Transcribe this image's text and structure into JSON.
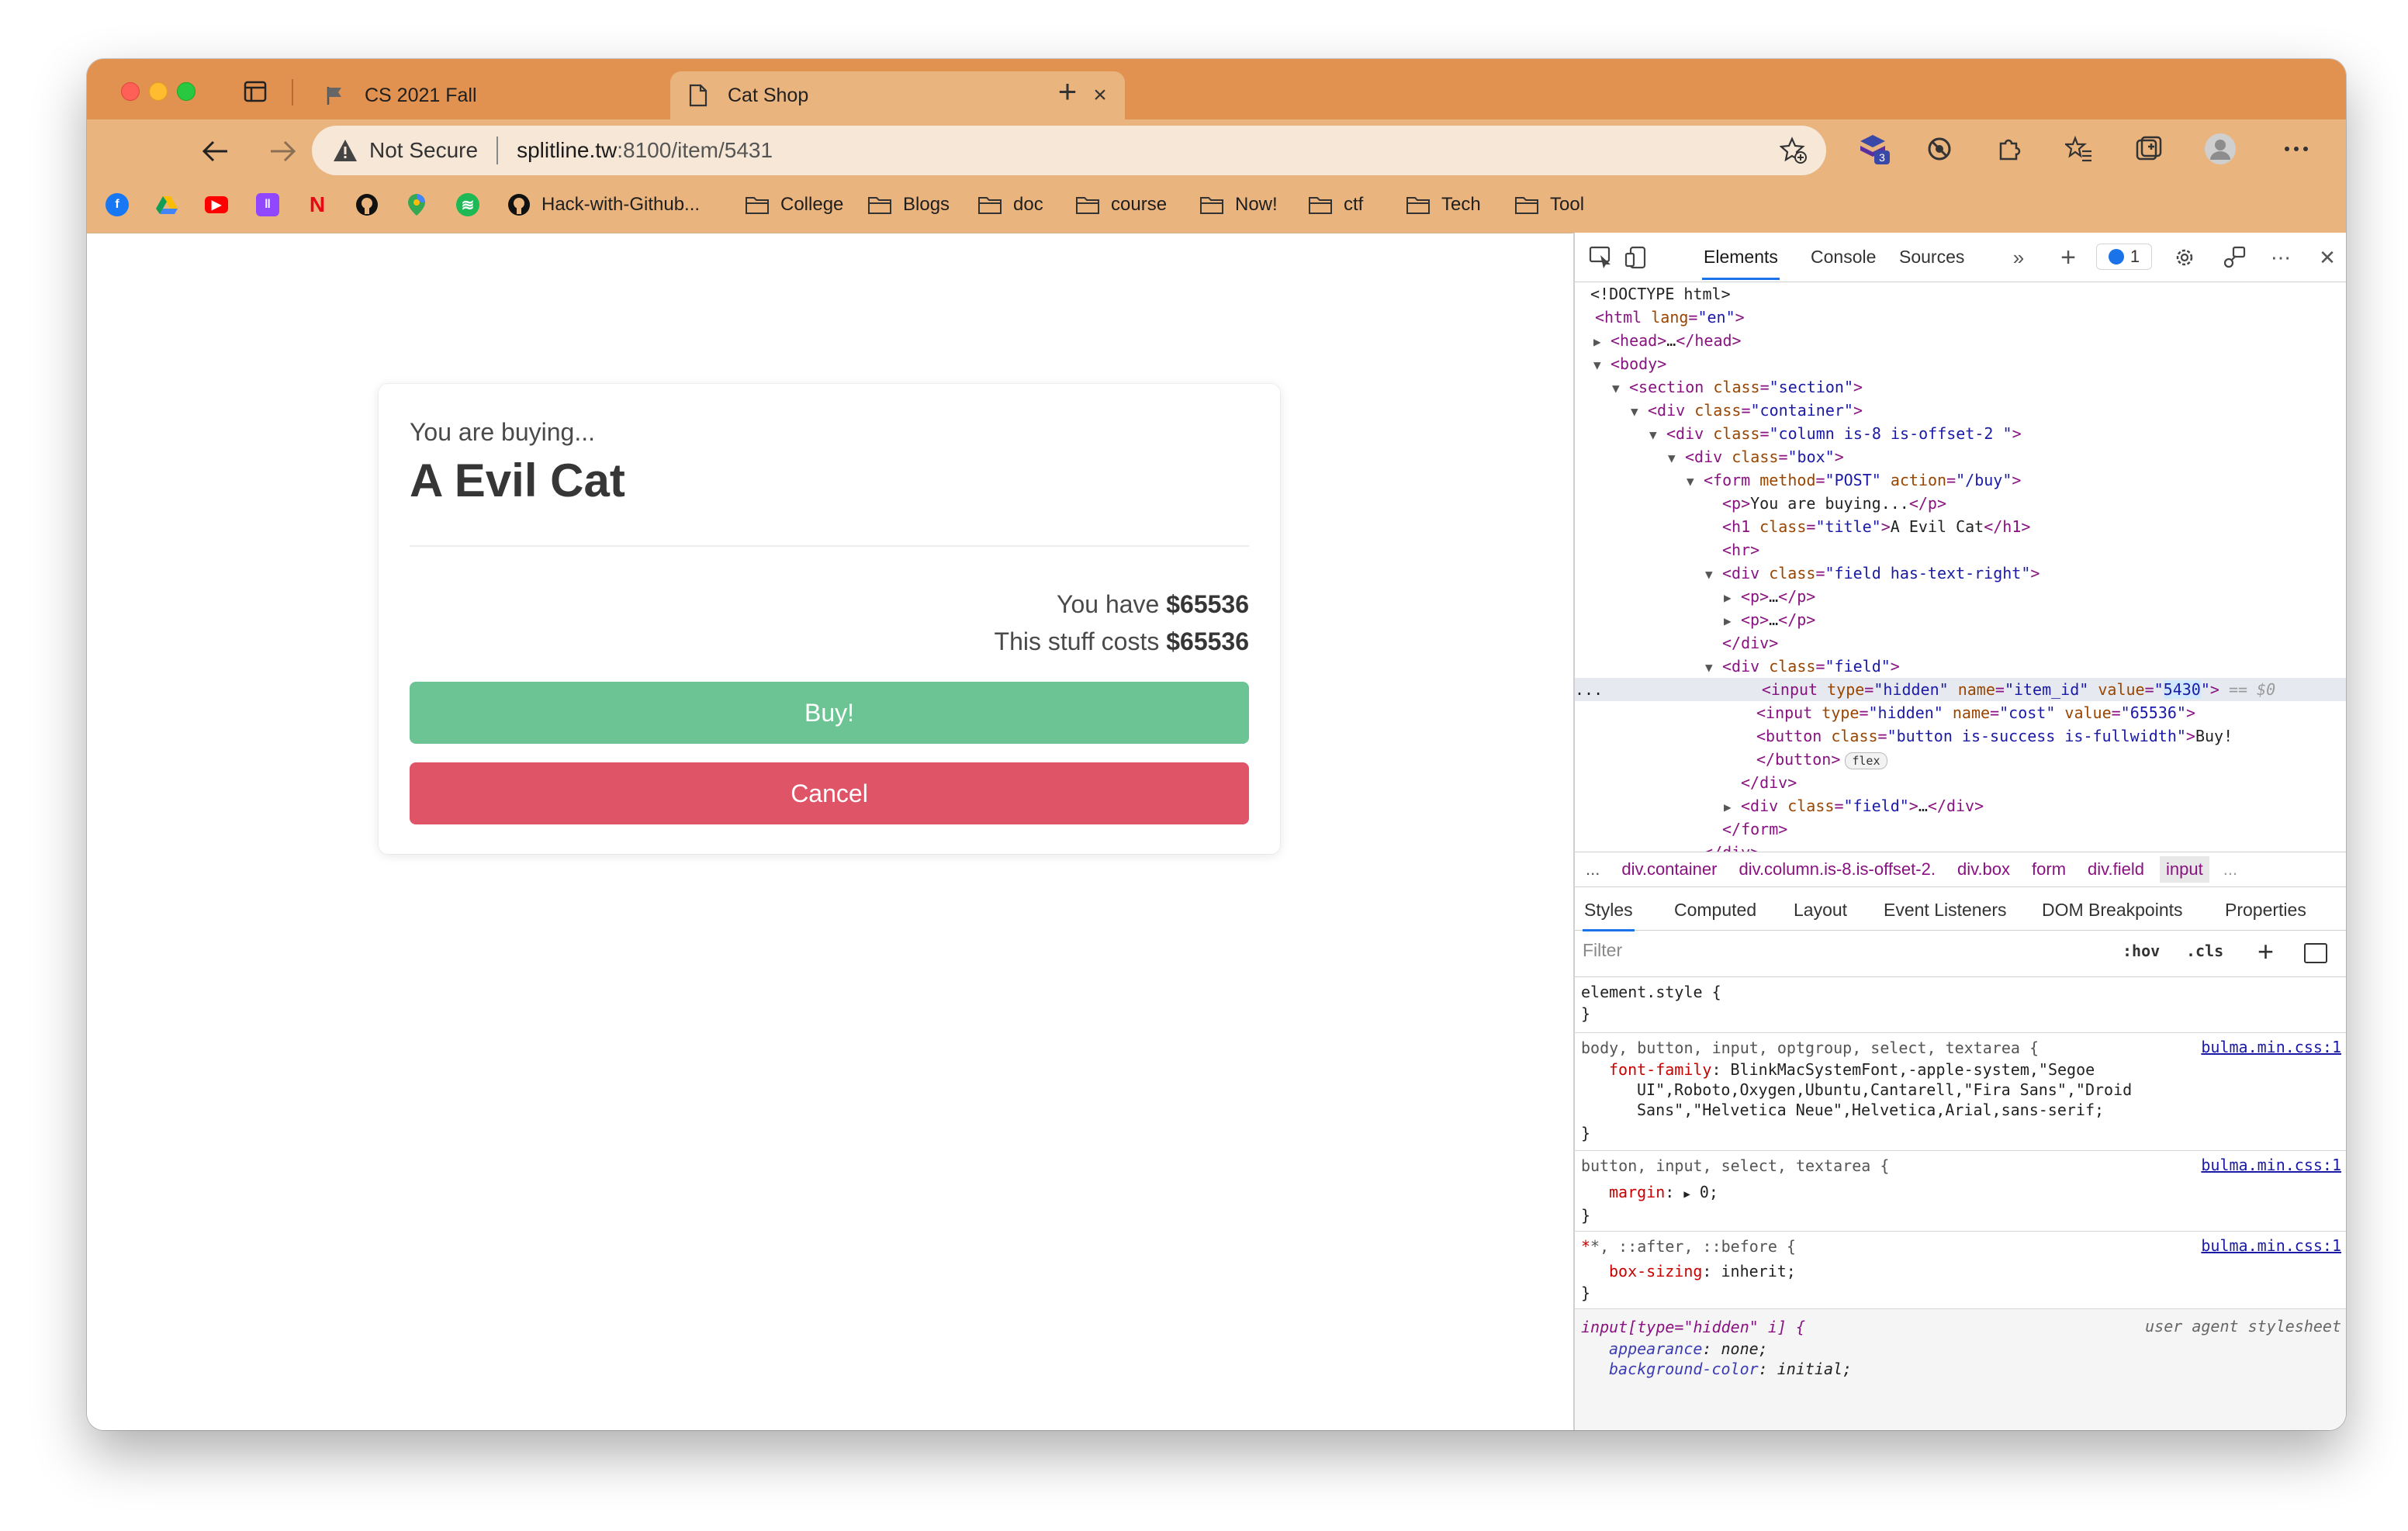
{
  "browser": {
    "tabs": [
      {
        "label": "CS 2021 Fall",
        "icon": "flag-icon",
        "active": false
      },
      {
        "label": "Cat Shop",
        "icon": "page-icon",
        "active": true
      }
    ],
    "security_label": "Not Secure",
    "url_host": "splitline.tw",
    "url_rest": ":8100/item/5431",
    "extension_badge": "3",
    "bookmarks": [
      {
        "label": "Hack-with-Github...",
        "icon": "github-icon"
      },
      {
        "label": "College",
        "icon": "folder-icon"
      },
      {
        "label": "Blogs",
        "icon": "folder-icon"
      },
      {
        "label": "doc",
        "icon": "folder-icon"
      },
      {
        "label": "course",
        "icon": "folder-icon"
      },
      {
        "label": "Now!",
        "icon": "folder-icon"
      },
      {
        "label": "ctf",
        "icon": "folder-icon"
      },
      {
        "label": "Tech",
        "icon": "folder-icon"
      },
      {
        "label": "Tool",
        "icon": "folder-icon"
      }
    ],
    "colors": {
      "tabstrip": "#e19150",
      "toolbar": "#eab47f"
    }
  },
  "page": {
    "subtitle": "You are buying...",
    "title": "A Evil Cat",
    "have_prefix": "You have ",
    "have_amount": "$65536",
    "cost_prefix": "This stuff costs ",
    "cost_amount": "$65536",
    "buy_label": "Buy!",
    "cancel_label": "Cancel",
    "colors": {
      "buy": "#6cc494",
      "cancel": "#e05468"
    }
  },
  "devtools": {
    "tabs": [
      "Elements",
      "Console",
      "Sources"
    ],
    "issues_count": "1",
    "dom": {
      "doctype": "<!DOCTYPE html>",
      "hidden_item_value": "5430",
      "selected_marker": "== $0",
      "button_text": "Buy!",
      "flex_badge": "flex",
      "ellipsis": "..."
    },
    "breadcrumbs": [
      "div.container",
      "div.column.is-8.is-offset-2.",
      "div.box",
      "form",
      "div.field",
      "input"
    ],
    "style_tabs": [
      "Styles",
      "Computed",
      "Layout",
      "Event Listeners",
      "DOM Breakpoints",
      "Properties"
    ],
    "filter_placeholder": "Filter",
    "hov_label": ":hov",
    "cls_label": ".cls",
    "styles": {
      "element_style": "element.style {",
      "rule1_selector": "body, button, input, optgroup, select, textarea {",
      "rule1_source": "bulma.min.css:1",
      "rule1_prop": "font-family",
      "rule1_value_1": "BlinkMacSystemFont,-apple-system,\"Segoe",
      "rule1_value_2": "UI\",Roboto,Oxygen,Ubuntu,Cantarell,\"Fira Sans\",\"Droid",
      "rule1_value_3": "Sans\",\"Helvetica Neue\",Helvetica,Arial,sans-serif;",
      "rule2_selector": "button, input, select, textarea {",
      "rule2_source": "bulma.min.css:1",
      "rule2_prop": "margin",
      "rule2_value": "0;",
      "rule3_selector": "*, ::after, ::before {",
      "rule3_source": "bulma.min.css:1",
      "rule3_prop": "box-sizing",
      "rule3_value": "inherit;",
      "rule4_selector": "input[type=\"hidden\" i] {",
      "rule4_source": "user agent stylesheet",
      "rule4_prop1": "appearance",
      "rule4_value1": "none;",
      "rule4_prop2": "background-color",
      "rule4_value2": "initial;"
    }
  }
}
